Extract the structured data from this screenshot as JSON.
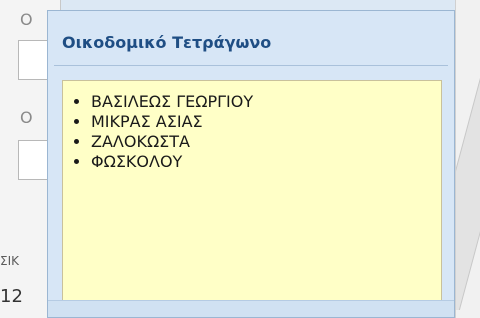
{
  "background_form": {
    "label_1": "O",
    "label_2": "O",
    "bottom_label": "ΣΙΚ",
    "bottom_value": "12"
  },
  "popup": {
    "title": "Οικοδομικό Τετράγωνο",
    "streets": [
      "ΒΑΣΙΛΕΩΣ ΓΕΩΡΓΙΟΥ",
      "ΜΙΚΡΑΣ ΑΣΙΑΣ",
      "ΖΑΛΟΚΩΣΤΑ",
      "ΦΩΣΚΟΛΟΥ"
    ]
  }
}
